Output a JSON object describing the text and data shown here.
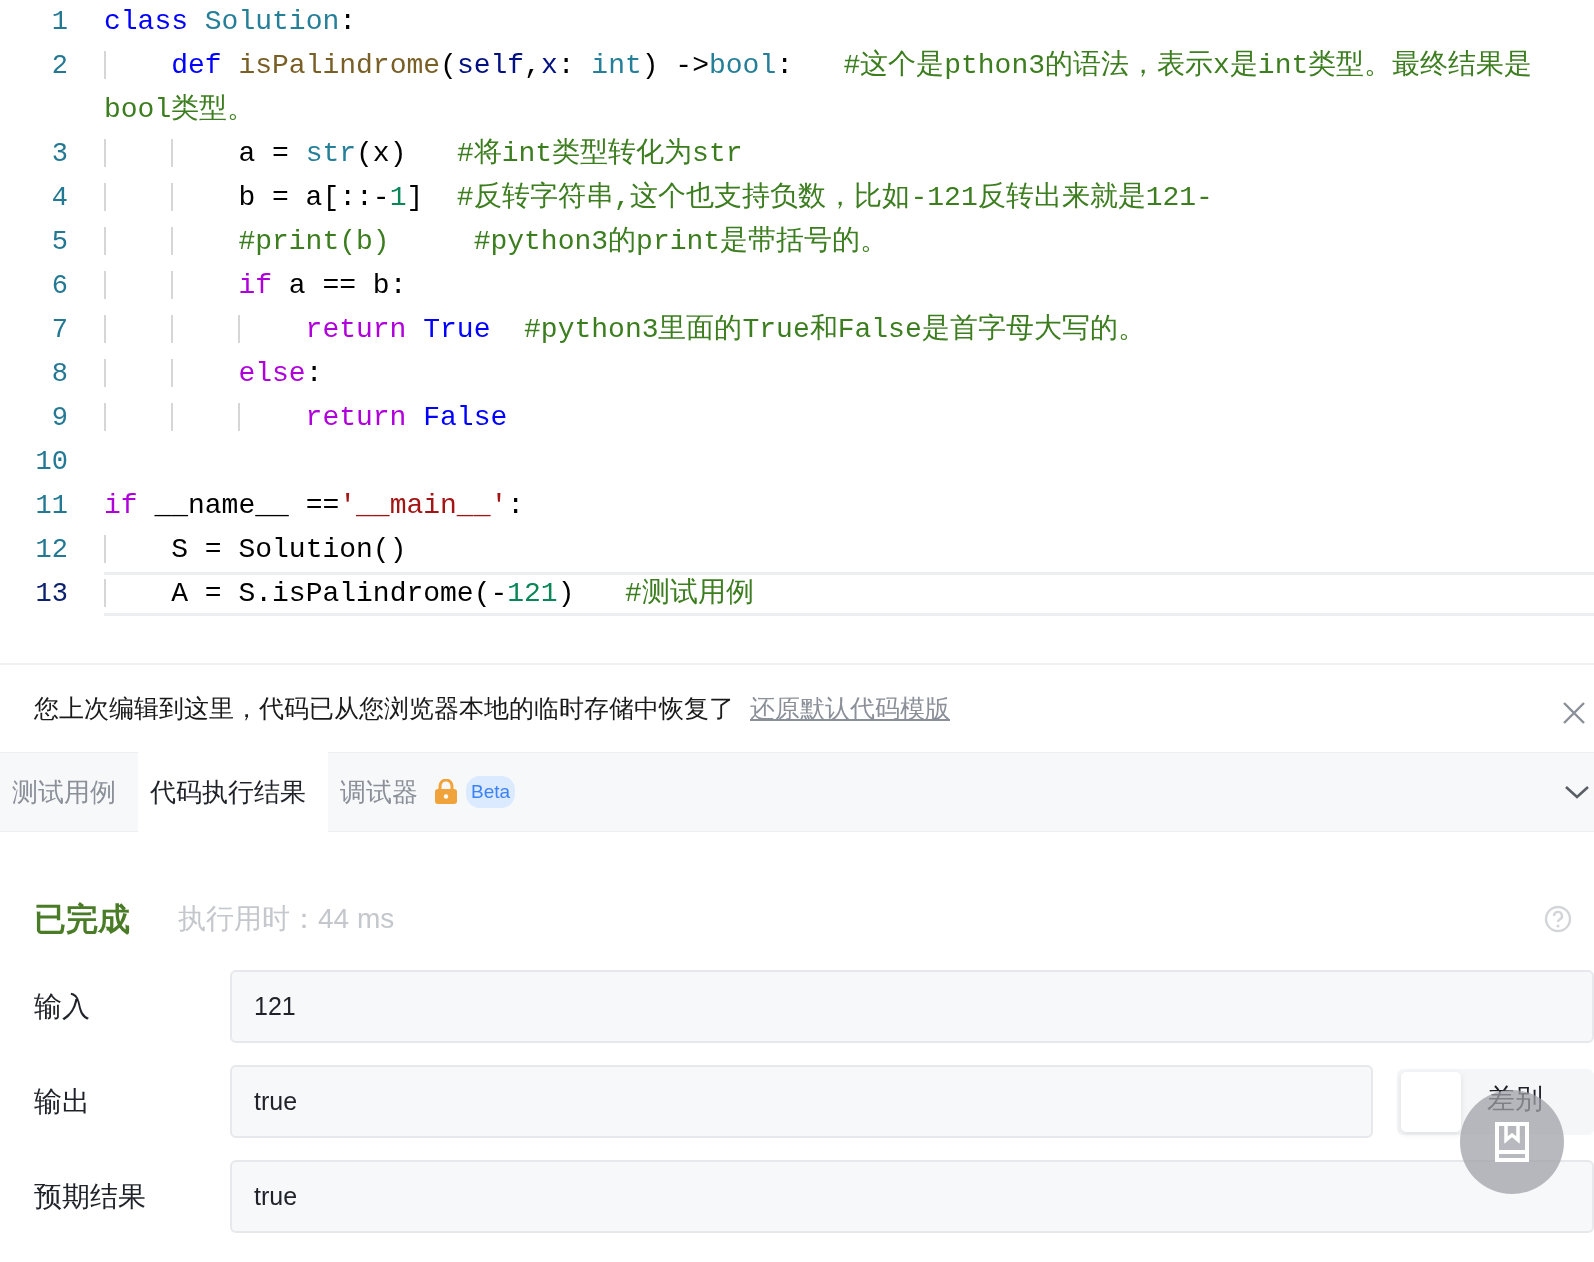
{
  "editor": {
    "lines": [
      {
        "number": "1",
        "current": false,
        "tokens": [
          {
            "kind": "keyword",
            "text": "class"
          },
          {
            "kind": "type",
            "text": " Solution"
          },
          {
            "kind": "plain",
            "text": ":"
          }
        ]
      },
      {
        "number": "2",
        "current": false,
        "tokens": [
          {
            "kind": "keyword",
            "text": "    def"
          },
          {
            "kind": "function",
            "text": " isPalindrome"
          },
          {
            "kind": "plain",
            "text": "("
          },
          {
            "kind": "param",
            "text": "self"
          },
          {
            "kind": "plain",
            "text": ","
          },
          {
            "kind": "param",
            "text": "x"
          },
          {
            "kind": "plain",
            "text": ": "
          },
          {
            "kind": "type",
            "text": "int"
          },
          {
            "kind": "plain",
            "text": ") ->"
          },
          {
            "kind": "type",
            "text": "bool"
          },
          {
            "kind": "plain",
            "text": ":"
          },
          {
            "kind": "comment",
            "text": "   #这个是pthon3的语法，表示x是int类型。最终结果是bool类型。"
          }
        ]
      },
      {
        "number": "3",
        "current": false,
        "tokens": [
          {
            "kind": "plain",
            "text": "        a = "
          },
          {
            "kind": "type",
            "text": "str"
          },
          {
            "kind": "plain",
            "text": "(x)"
          },
          {
            "kind": "comment",
            "text": "   #将int类型转化为str"
          }
        ]
      },
      {
        "number": "4",
        "current": false,
        "tokens": [
          {
            "kind": "plain",
            "text": "        b = a[::-"
          },
          {
            "kind": "number",
            "text": "1"
          },
          {
            "kind": "plain",
            "text": "]"
          },
          {
            "kind": "comment",
            "text": "  #反转字符串,这个也支持负数，比如-121反转出来就是121-"
          }
        ]
      },
      {
        "number": "5",
        "current": false,
        "tokens": [
          {
            "kind": "comment",
            "text": "        #print(b)"
          },
          {
            "kind": "comment",
            "text": "     #python3的print是带括号的。"
          }
        ]
      },
      {
        "number": "6",
        "current": false,
        "tokens": [
          {
            "kind": "control",
            "text": "        if"
          },
          {
            "kind": "plain",
            "text": " a == b:"
          }
        ]
      },
      {
        "number": "7",
        "current": false,
        "tokens": [
          {
            "kind": "control",
            "text": "            return"
          },
          {
            "kind": "constant",
            "text": " True"
          },
          {
            "kind": "comment",
            "text": "  #python3里面的True和False是首字母大写的。"
          }
        ]
      },
      {
        "number": "8",
        "current": false,
        "tokens": [
          {
            "kind": "control",
            "text": "        else"
          },
          {
            "kind": "plain",
            "text": ":"
          }
        ]
      },
      {
        "number": "9",
        "current": false,
        "tokens": [
          {
            "kind": "control",
            "text": "            return"
          },
          {
            "kind": "constant",
            "text": " False"
          }
        ]
      },
      {
        "number": "10",
        "current": false
      },
      {
        "number": "11",
        "current": false,
        "tokens": [
          {
            "kind": "control",
            "text": "if"
          },
          {
            "kind": "plain",
            "text": " __name__ =="
          },
          {
            "kind": "string",
            "text": "'__main__'"
          },
          {
            "kind": "plain",
            "text": ":"
          }
        ]
      },
      {
        "number": "12",
        "current": false,
        "tokens": [
          {
            "kind": "plain",
            "text": "    S = Solution()"
          }
        ]
      },
      {
        "number": "13",
        "current": true,
        "tokens": [
          {
            "kind": "plain",
            "text": "    A = S.isPalindrome(-"
          },
          {
            "kind": "number",
            "text": "121"
          },
          {
            "kind": "plain",
            "text": ")"
          },
          {
            "kind": "comment",
            "text": "   #测试用例"
          }
        ]
      }
    ]
  },
  "notice": {
    "text": "您上次编辑到这里，代码已从您浏览器本地的临时存储中恢复了",
    "link": "还原默认代码模版"
  },
  "tabs": [
    {
      "label": "测试用例",
      "selected": false
    },
    {
      "label": "代码执行结果",
      "selected": true
    },
    {
      "label": "调试器",
      "selected": false,
      "locked": true,
      "badge": "Beta"
    }
  ],
  "result": {
    "status": "已完成",
    "runtime": "执行用时：44 ms",
    "rows": [
      {
        "kind": "plain",
        "label": "输入",
        "value": "121"
      },
      {
        "kind": "diff",
        "label": "输出",
        "value": "true",
        "toggle": {
          "label": "差别",
          "on": false
        }
      },
      {
        "kind": "plain",
        "label": "预期结果",
        "value": "true"
      }
    ]
  }
}
